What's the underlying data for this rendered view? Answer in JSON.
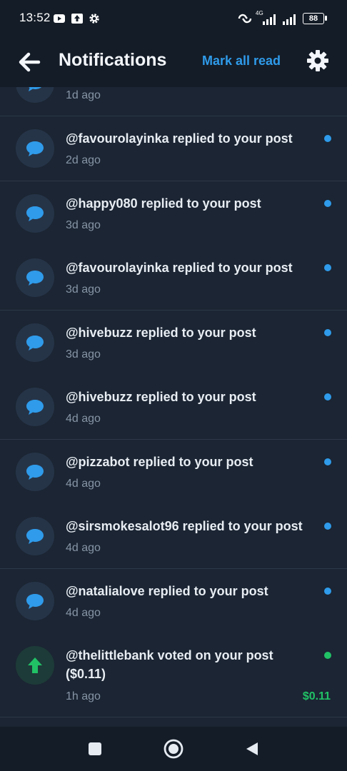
{
  "status_bar": {
    "time": "13:52",
    "network": "4G",
    "battery": "88"
  },
  "app_bar": {
    "title": "Notifications",
    "mark_all_read": "Mark all read"
  },
  "notifications": [
    {
      "text": "",
      "time": "1d ago",
      "icon": "chat-bubble-icon",
      "unread": false
    },
    {
      "text": "@favourolayinka replied to your post",
      "time": "2d ago",
      "icon": "chat-bubble-icon",
      "unread": true
    },
    {
      "text": "@happy080 replied to your post",
      "time": "3d ago",
      "icon": "chat-bubble-icon",
      "unread": true
    },
    {
      "text": "@favourolayinka replied to your post",
      "time": "3d ago",
      "icon": "chat-bubble-icon",
      "unread": true
    },
    {
      "text": "@hivebuzz replied to your post",
      "time": "3d ago",
      "icon": "chat-bubble-icon",
      "unread": true
    },
    {
      "text": "@hivebuzz replied to your post",
      "time": "4d ago",
      "icon": "chat-bubble-icon",
      "unread": true
    },
    {
      "text": "@pizzabot replied to your post",
      "time": "4d ago",
      "icon": "chat-bubble-icon",
      "unread": true
    },
    {
      "text": "@sirsmokesalot96 replied to your post",
      "time": "4d ago",
      "icon": "chat-bubble-icon",
      "unread": true
    },
    {
      "text": "@natalialove replied to your post",
      "time": "4d ago",
      "icon": "chat-bubble-icon",
      "unread": true
    },
    {
      "text": "@thelittlebank voted on your post ($0.11)",
      "time": "1h ago",
      "icon": "upvote-arrow-icon",
      "unread": true,
      "amount": "$0.11"
    }
  ],
  "colors": {
    "accent": "#2f9bea",
    "vote": "#21c266",
    "background": "#1b2533",
    "bar": "#141c27"
  }
}
